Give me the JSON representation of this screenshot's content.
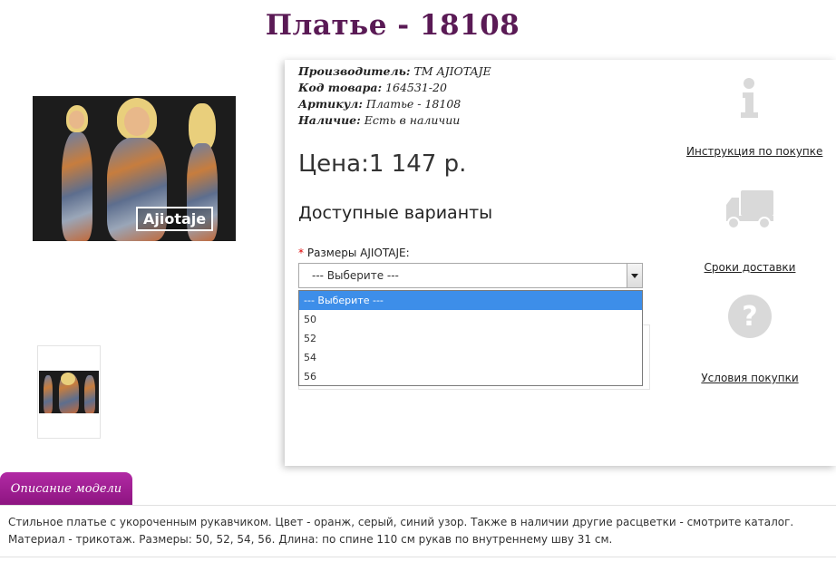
{
  "product": {
    "title": "Платье - 18108",
    "manufacturer_label": "Производитель:",
    "manufacturer_value": "ТМ AJIOTAJE",
    "code_label": "Код товара:",
    "code_value": "164531-20",
    "article_label": "Артикул:",
    "article_value": "Платье - 18108",
    "stock_label": "Наличие:",
    "stock_value": "Есть в наличии",
    "price": "Цена:1 147 р.",
    "variants_title": "Доступные варианты",
    "size_required_mark": "*",
    "size_label": "Размеры AJIOTAJE:",
    "photo_brand": "Ajiotaje"
  },
  "size_select": {
    "value": "--- Выберите ---",
    "options": [
      "--- Выберите ---",
      "50",
      "52",
      "54",
      "56"
    ]
  },
  "sidebar": {
    "instruction": "Инструкция по покупке",
    "delivery": "Сроки доставки",
    "conditions": "Условия покупки"
  },
  "description": {
    "tab": "Описание модели",
    "text": "Стильное платье с укороченным рукавчиком. Цвет - оранж, серый, синий узор. Также в наличии другие расцветки - смотрите каталог. Материал - трикотаж. Размеры: 50, 52, 54, 56. Длина: по спине 110 см рукав по внутреннему шву 31 см."
  },
  "colors": {
    "title": "#5a1a55",
    "tab": "#9b1b8f",
    "highlight": "#3d8ee9",
    "icon_gray": "#d9d9d9"
  }
}
